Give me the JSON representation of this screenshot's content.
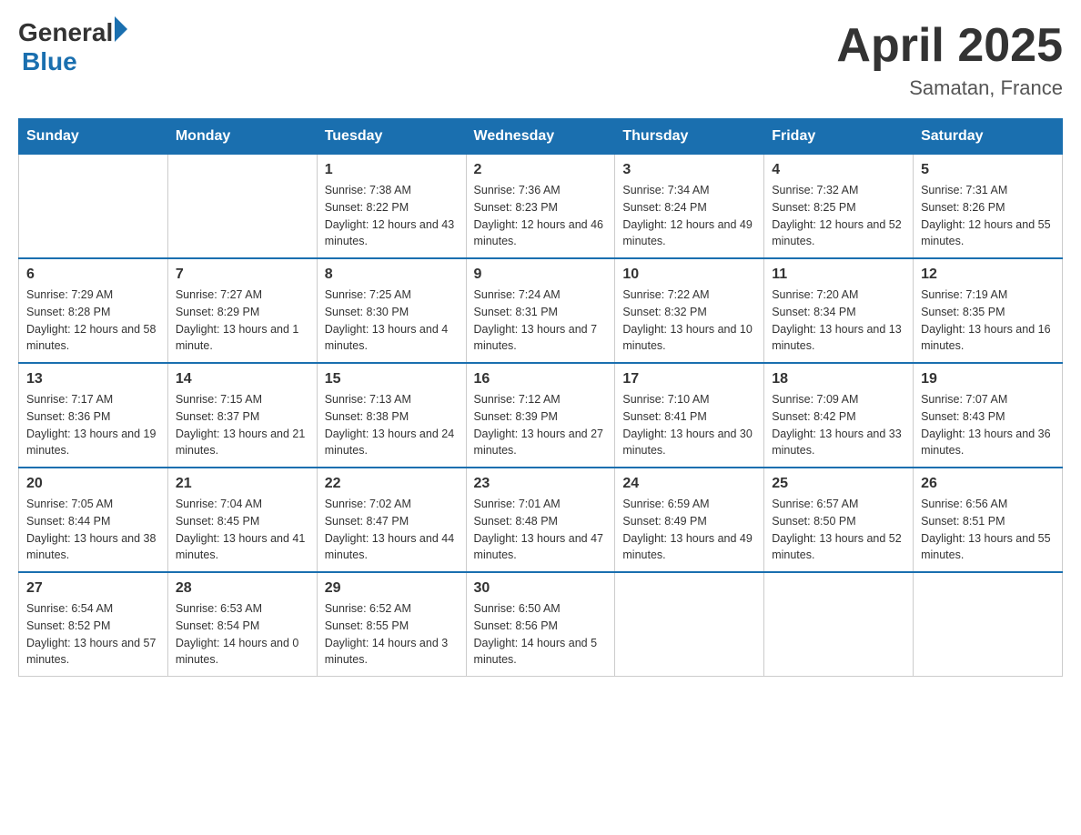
{
  "header": {
    "logo_general": "General",
    "logo_blue": "Blue",
    "title": "April 2025",
    "subtitle": "Samatan, France"
  },
  "weekdays": [
    "Sunday",
    "Monday",
    "Tuesday",
    "Wednesday",
    "Thursday",
    "Friday",
    "Saturday"
  ],
  "weeks": [
    [
      {
        "day": "",
        "sunrise": "",
        "sunset": "",
        "daylight": ""
      },
      {
        "day": "",
        "sunrise": "",
        "sunset": "",
        "daylight": ""
      },
      {
        "day": "1",
        "sunrise": "Sunrise: 7:38 AM",
        "sunset": "Sunset: 8:22 PM",
        "daylight": "Daylight: 12 hours and 43 minutes."
      },
      {
        "day": "2",
        "sunrise": "Sunrise: 7:36 AM",
        "sunset": "Sunset: 8:23 PM",
        "daylight": "Daylight: 12 hours and 46 minutes."
      },
      {
        "day": "3",
        "sunrise": "Sunrise: 7:34 AM",
        "sunset": "Sunset: 8:24 PM",
        "daylight": "Daylight: 12 hours and 49 minutes."
      },
      {
        "day": "4",
        "sunrise": "Sunrise: 7:32 AM",
        "sunset": "Sunset: 8:25 PM",
        "daylight": "Daylight: 12 hours and 52 minutes."
      },
      {
        "day": "5",
        "sunrise": "Sunrise: 7:31 AM",
        "sunset": "Sunset: 8:26 PM",
        "daylight": "Daylight: 12 hours and 55 minutes."
      }
    ],
    [
      {
        "day": "6",
        "sunrise": "Sunrise: 7:29 AM",
        "sunset": "Sunset: 8:28 PM",
        "daylight": "Daylight: 12 hours and 58 minutes."
      },
      {
        "day": "7",
        "sunrise": "Sunrise: 7:27 AM",
        "sunset": "Sunset: 8:29 PM",
        "daylight": "Daylight: 13 hours and 1 minute."
      },
      {
        "day": "8",
        "sunrise": "Sunrise: 7:25 AM",
        "sunset": "Sunset: 8:30 PM",
        "daylight": "Daylight: 13 hours and 4 minutes."
      },
      {
        "day": "9",
        "sunrise": "Sunrise: 7:24 AM",
        "sunset": "Sunset: 8:31 PM",
        "daylight": "Daylight: 13 hours and 7 minutes."
      },
      {
        "day": "10",
        "sunrise": "Sunrise: 7:22 AM",
        "sunset": "Sunset: 8:32 PM",
        "daylight": "Daylight: 13 hours and 10 minutes."
      },
      {
        "day": "11",
        "sunrise": "Sunrise: 7:20 AM",
        "sunset": "Sunset: 8:34 PM",
        "daylight": "Daylight: 13 hours and 13 minutes."
      },
      {
        "day": "12",
        "sunrise": "Sunrise: 7:19 AM",
        "sunset": "Sunset: 8:35 PM",
        "daylight": "Daylight: 13 hours and 16 minutes."
      }
    ],
    [
      {
        "day": "13",
        "sunrise": "Sunrise: 7:17 AM",
        "sunset": "Sunset: 8:36 PM",
        "daylight": "Daylight: 13 hours and 19 minutes."
      },
      {
        "day": "14",
        "sunrise": "Sunrise: 7:15 AM",
        "sunset": "Sunset: 8:37 PM",
        "daylight": "Daylight: 13 hours and 21 minutes."
      },
      {
        "day": "15",
        "sunrise": "Sunrise: 7:13 AM",
        "sunset": "Sunset: 8:38 PM",
        "daylight": "Daylight: 13 hours and 24 minutes."
      },
      {
        "day": "16",
        "sunrise": "Sunrise: 7:12 AM",
        "sunset": "Sunset: 8:39 PM",
        "daylight": "Daylight: 13 hours and 27 minutes."
      },
      {
        "day": "17",
        "sunrise": "Sunrise: 7:10 AM",
        "sunset": "Sunset: 8:41 PM",
        "daylight": "Daylight: 13 hours and 30 minutes."
      },
      {
        "day": "18",
        "sunrise": "Sunrise: 7:09 AM",
        "sunset": "Sunset: 8:42 PM",
        "daylight": "Daylight: 13 hours and 33 minutes."
      },
      {
        "day": "19",
        "sunrise": "Sunrise: 7:07 AM",
        "sunset": "Sunset: 8:43 PM",
        "daylight": "Daylight: 13 hours and 36 minutes."
      }
    ],
    [
      {
        "day": "20",
        "sunrise": "Sunrise: 7:05 AM",
        "sunset": "Sunset: 8:44 PM",
        "daylight": "Daylight: 13 hours and 38 minutes."
      },
      {
        "day": "21",
        "sunrise": "Sunrise: 7:04 AM",
        "sunset": "Sunset: 8:45 PM",
        "daylight": "Daylight: 13 hours and 41 minutes."
      },
      {
        "day": "22",
        "sunrise": "Sunrise: 7:02 AM",
        "sunset": "Sunset: 8:47 PM",
        "daylight": "Daylight: 13 hours and 44 minutes."
      },
      {
        "day": "23",
        "sunrise": "Sunrise: 7:01 AM",
        "sunset": "Sunset: 8:48 PM",
        "daylight": "Daylight: 13 hours and 47 minutes."
      },
      {
        "day": "24",
        "sunrise": "Sunrise: 6:59 AM",
        "sunset": "Sunset: 8:49 PM",
        "daylight": "Daylight: 13 hours and 49 minutes."
      },
      {
        "day": "25",
        "sunrise": "Sunrise: 6:57 AM",
        "sunset": "Sunset: 8:50 PM",
        "daylight": "Daylight: 13 hours and 52 minutes."
      },
      {
        "day": "26",
        "sunrise": "Sunrise: 6:56 AM",
        "sunset": "Sunset: 8:51 PM",
        "daylight": "Daylight: 13 hours and 55 minutes."
      }
    ],
    [
      {
        "day": "27",
        "sunrise": "Sunrise: 6:54 AM",
        "sunset": "Sunset: 8:52 PM",
        "daylight": "Daylight: 13 hours and 57 minutes."
      },
      {
        "day": "28",
        "sunrise": "Sunrise: 6:53 AM",
        "sunset": "Sunset: 8:54 PM",
        "daylight": "Daylight: 14 hours and 0 minutes."
      },
      {
        "day": "29",
        "sunrise": "Sunrise: 6:52 AM",
        "sunset": "Sunset: 8:55 PM",
        "daylight": "Daylight: 14 hours and 3 minutes."
      },
      {
        "day": "30",
        "sunrise": "Sunrise: 6:50 AM",
        "sunset": "Sunset: 8:56 PM",
        "daylight": "Daylight: 14 hours and 5 minutes."
      },
      {
        "day": "",
        "sunrise": "",
        "sunset": "",
        "daylight": ""
      },
      {
        "day": "",
        "sunrise": "",
        "sunset": "",
        "daylight": ""
      },
      {
        "day": "",
        "sunrise": "",
        "sunset": "",
        "daylight": ""
      }
    ]
  ]
}
